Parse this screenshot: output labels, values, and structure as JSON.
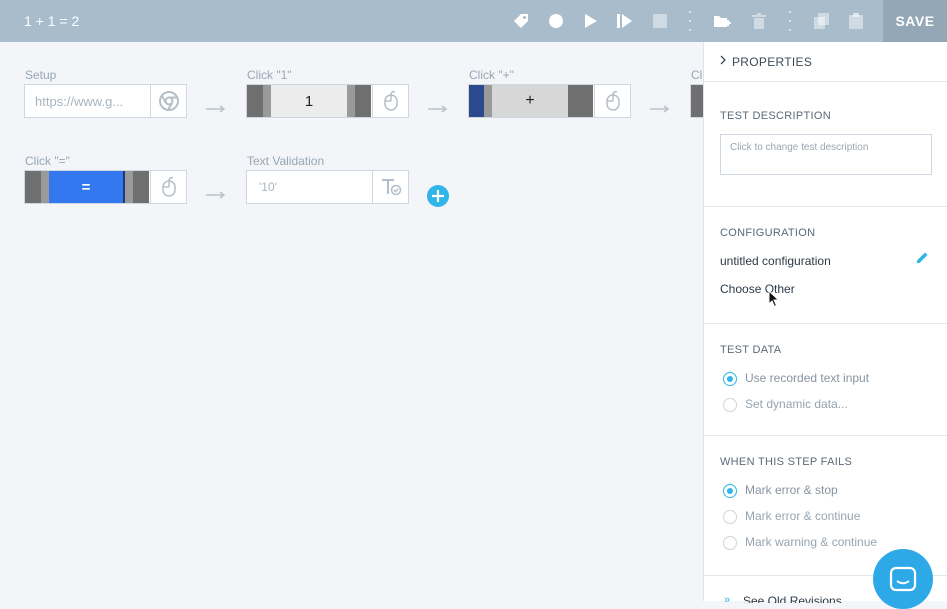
{
  "header": {
    "title": "1 + 1 = 2",
    "save_label": "SAVE",
    "icons": [
      "tag-icon",
      "record-icon",
      "play-icon",
      "step-forward-icon",
      "stop-icon",
      "add-folder-icon",
      "trash-icon",
      "copy-icon",
      "paste-icon"
    ]
  },
  "steps": [
    {
      "label": "Setup",
      "value": "https://www.g...",
      "icon": "chrome-icon"
    },
    {
      "label": "Click \"1\"",
      "value": "1",
      "icon": "mouse-icon"
    },
    {
      "label": "Click \"+\"",
      "value": "+",
      "icon": "mouse-icon"
    },
    {
      "label": "Cl",
      "value": "",
      "icon": ""
    },
    {
      "label": "Click \"=\"",
      "value": "=",
      "icon": "mouse-icon"
    },
    {
      "label": "Text Validation",
      "value": "'10'",
      "icon": "text-check-icon"
    }
  ],
  "panel": {
    "properties_label": "PROPERTIES",
    "test_description": {
      "title": "TEST DESCRIPTION",
      "placeholder": "Click to change test description"
    },
    "configuration": {
      "title": "CONFIGURATION",
      "current": "untitled configuration",
      "choose_other": "Choose Other"
    },
    "test_data": {
      "title": "TEST DATA",
      "options": [
        "Use recorded text input",
        "Set dynamic data..."
      ],
      "selected": 0
    },
    "fails": {
      "title": "WHEN THIS STEP FAILS",
      "options": [
        "Mark error & stop",
        "Mark error & continue",
        "Mark warning & continue"
      ],
      "selected": 0
    },
    "old_revisions": "See Old Revisions"
  },
  "colors": {
    "topbar": "#a8bccb",
    "accent": "#2fb5e8",
    "save_bg": "#93a7b6"
  }
}
